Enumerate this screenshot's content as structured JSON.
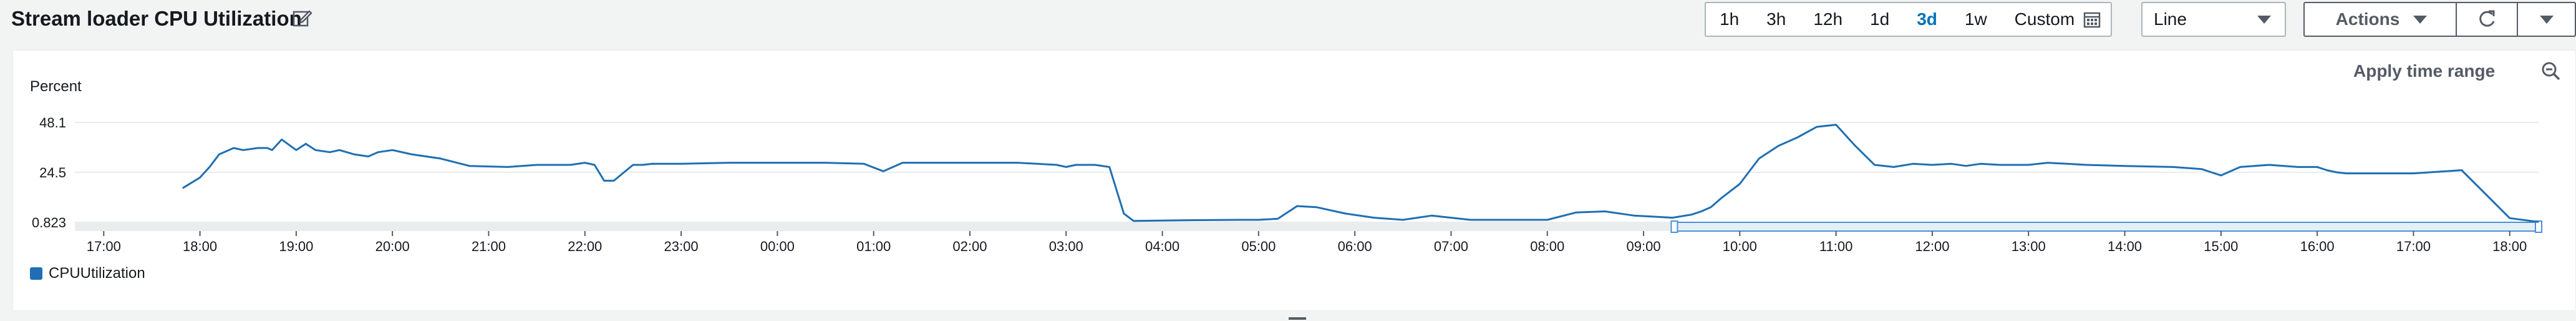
{
  "header": {
    "title": "Stream loader CPU Utilization",
    "edit_icon": "edit-icon"
  },
  "time_range": {
    "options": [
      "1h",
      "3h",
      "12h",
      "1d",
      "3d",
      "1w"
    ],
    "selected": "3d",
    "custom_label": "Custom",
    "custom_icon": "calendar-icon"
  },
  "chart_type_select": {
    "value": "Line",
    "icon": "chevron-down-icon"
  },
  "actions": {
    "label": "Actions",
    "icon": "chevron-down-icon"
  },
  "refresh": {
    "icon": "refresh-icon",
    "dropdown_icon": "chevron-down-icon"
  },
  "panel": {
    "apply_time_range": "Apply time range",
    "zoom_icon": "zoom-out-icon"
  },
  "colors": {
    "series": "#1f6fb2",
    "selection_fill": "#e3f0fa",
    "selection_border": "#4a90d9",
    "axis": "#545b64",
    "grid": "#e9ebed",
    "scrollbar": "#d5dbdb"
  },
  "chart_data": {
    "type": "line",
    "ylabel": "Percent",
    "y_ticks": [
      "48.1",
      "24.5",
      "0.823"
    ],
    "y_tick_values": [
      48.1,
      24.5,
      0.823
    ],
    "ylim": [
      0.823,
      48.1
    ],
    "x_tick_labels": [
      "17:00",
      "18:00",
      "19:00",
      "20:00",
      "21:00",
      "22:00",
      "23:00",
      "00:00",
      "01:00",
      "02:00",
      "03:00",
      "04:00",
      "05:00",
      "06:00",
      "07:00",
      "08:00",
      "09:00",
      "10:00",
      "11:00",
      "12:00",
      "13:00",
      "14:00",
      "15:00",
      "16:00",
      "17:00",
      "18:00"
    ],
    "x_unit": "hours since 17:00",
    "xlim": [
      -0.3,
      25.3
    ],
    "grid": "horizontal",
    "legend_position": "bottom-left",
    "selection_range": [
      16.32,
      25.3
    ],
    "series": [
      {
        "name": "CPUUtilization",
        "x": [
          0.82,
          1.0,
          1.1,
          1.2,
          1.35,
          1.45,
          1.6,
          1.7,
          1.75,
          1.85,
          2.0,
          2.1,
          2.2,
          2.35,
          2.45,
          2.6,
          2.75,
          2.85,
          3.0,
          3.2,
          3.5,
          3.8,
          4.2,
          4.5,
          4.85,
          5.0,
          5.1,
          5.2,
          5.3,
          5.5,
          5.6,
          5.7,
          5.8,
          6.0,
          6.5,
          7.0,
          7.5,
          7.9,
          8.1,
          8.3,
          8.6,
          9.0,
          9.5,
          9.9,
          10.0,
          10.1,
          10.3,
          10.45,
          10.6,
          10.7,
          11.2,
          11.8,
          12.0,
          12.2,
          12.4,
          12.6,
          12.9,
          13.2,
          13.5,
          13.8,
          14.2,
          14.5,
          14.8,
          15.0,
          15.3,
          15.6,
          15.9,
          16.1,
          16.3,
          16.5,
          16.6,
          16.7,
          16.8,
          17.0,
          17.2,
          17.4,
          17.6,
          17.8,
          18.0,
          18.2,
          18.4,
          18.6,
          18.8,
          19.0,
          19.2,
          19.35,
          19.5,
          19.7,
          20.0,
          20.2,
          20.4,
          20.6,
          21.0,
          21.5,
          21.8,
          22.0,
          22.2,
          22.5,
          22.8,
          23.0,
          23.1,
          23.2,
          23.3,
          23.5,
          24.0,
          24.5,
          25.0,
          25.3
        ],
        "y": [
          17.0,
          22.0,
          27.0,
          33.0,
          36.0,
          35.0,
          36.0,
          36.0,
          35.0,
          40.0,
          35.0,
          38.0,
          35.0,
          34.0,
          35.0,
          33.0,
          32.0,
          34.0,
          35.0,
          33.0,
          31.0,
          27.5,
          27.0,
          28.0,
          28.0,
          29.0,
          28.0,
          20.5,
          20.5,
          28.0,
          28.0,
          28.5,
          28.5,
          28.5,
          29.0,
          29.0,
          29.0,
          28.5,
          25.0,
          29.0,
          29.0,
          29.0,
          29.0,
          28.0,
          27.0,
          28.0,
          28.0,
          27.0,
          5.0,
          1.5,
          1.8,
          2.0,
          2.0,
          2.5,
          8.5,
          8.0,
          5.0,
          3.0,
          2.0,
          4.0,
          2.0,
          2.0,
          2.0,
          2.0,
          5.5,
          6.0,
          4.0,
          3.5,
          3.0,
          4.5,
          6.0,
          8.0,
          12.0,
          19.0,
          31.0,
          37.0,
          41.0,
          46.0,
          47.0,
          37.0,
          28.0,
          27.0,
          28.5,
          28.0,
          28.5,
          27.5,
          28.5,
          28.0,
          28.0,
          29.0,
          28.5,
          28.0,
          27.5,
          27.0,
          26.0,
          23.0,
          27.0,
          28.0,
          27.0,
          27.0,
          25.5,
          24.5,
          24.0,
          24.0,
          24.0,
          25.5,
          2.8,
          1.0
        ]
      }
    ]
  }
}
